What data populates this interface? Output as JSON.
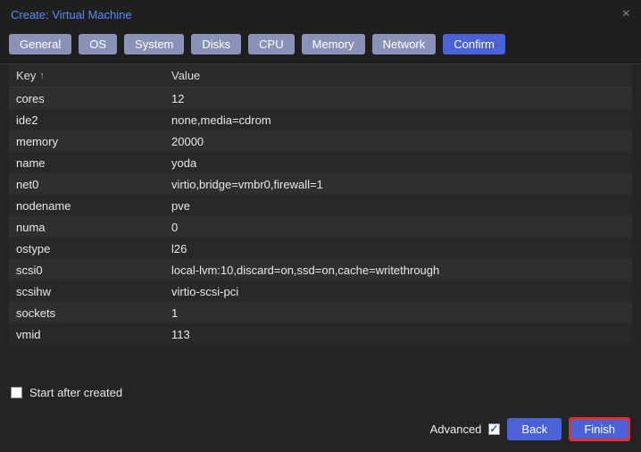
{
  "title": "Create: Virtual Machine",
  "tabs": [
    {
      "label": "General",
      "active": false
    },
    {
      "label": "OS",
      "active": false
    },
    {
      "label": "System",
      "active": false
    },
    {
      "label": "Disks",
      "active": false
    },
    {
      "label": "CPU",
      "active": false
    },
    {
      "label": "Memory",
      "active": false
    },
    {
      "label": "Network",
      "active": false
    },
    {
      "label": "Confirm",
      "active": true
    }
  ],
  "table": {
    "head_key": "Key",
    "head_value": "Value",
    "sort_indicator": "↑",
    "rows": [
      {
        "k": "cores",
        "v": "12"
      },
      {
        "k": "ide2",
        "v": "none,media=cdrom"
      },
      {
        "k": "memory",
        "v": "20000"
      },
      {
        "k": "name",
        "v": "yoda"
      },
      {
        "k": "net0",
        "v": "virtio,bridge=vmbr0,firewall=1"
      },
      {
        "k": "nodename",
        "v": "pve"
      },
      {
        "k": "numa",
        "v": "0"
      },
      {
        "k": "ostype",
        "v": "l26"
      },
      {
        "k": "scsi0",
        "v": "local-lvm:10,discard=on,ssd=on,cache=writethrough"
      },
      {
        "k": "scsihw",
        "v": "virtio-scsi-pci"
      },
      {
        "k": "sockets",
        "v": "1"
      },
      {
        "k": "vmid",
        "v": "113"
      }
    ]
  },
  "start_after_label": "Start after created",
  "start_after_checked": false,
  "advanced_label": "Advanced",
  "advanced_checked": true,
  "back_label": "Back",
  "finish_label": "Finish"
}
